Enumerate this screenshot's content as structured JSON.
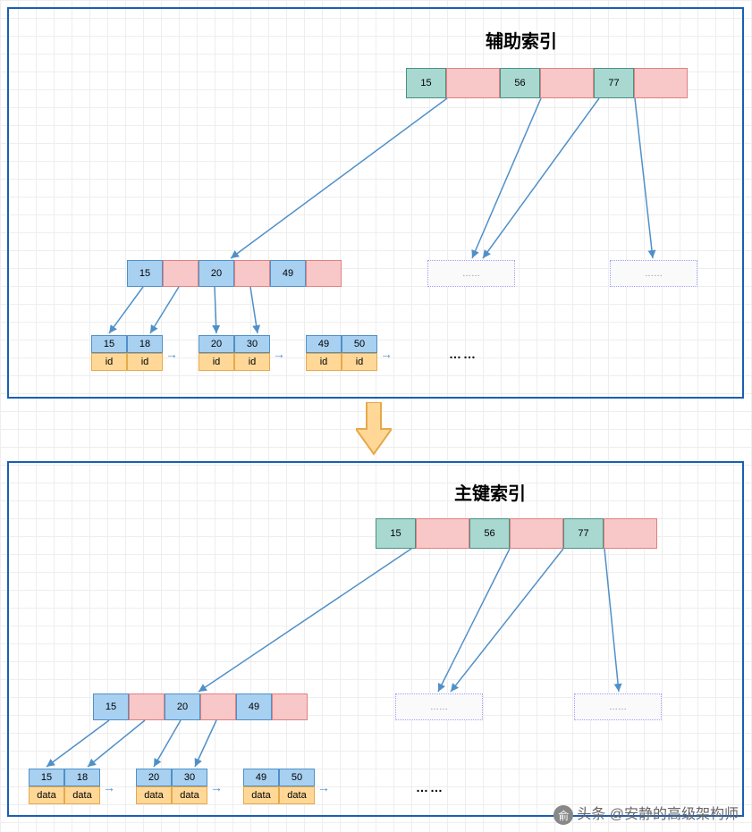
{
  "section1": {
    "title": "辅助索引",
    "root": [
      "15",
      "",
      "56",
      "",
      "77",
      ""
    ],
    "mid": [
      "15",
      "",
      "20",
      "",
      "49",
      ""
    ],
    "leaves": [
      {
        "top": [
          "15",
          "18"
        ],
        "bot": [
          "id",
          "id"
        ]
      },
      {
        "top": [
          "20",
          "30"
        ],
        "bot": [
          "id",
          "id"
        ]
      },
      {
        "top": [
          "49",
          "50"
        ],
        "bot": [
          "id",
          "id"
        ]
      }
    ],
    "placeholder": "……",
    "dots": "……"
  },
  "section2": {
    "title": "主键索引",
    "root": [
      "15",
      "",
      "56",
      "",
      "77",
      ""
    ],
    "mid": [
      "15",
      "",
      "20",
      "",
      "49",
      ""
    ],
    "leaves": [
      {
        "top": [
          "15",
          "18"
        ],
        "bot": [
          "data",
          "data"
        ]
      },
      {
        "top": [
          "20",
          "30"
        ],
        "bot": [
          "data",
          "data"
        ]
      },
      {
        "top": [
          "49",
          "50"
        ],
        "bot": [
          "data",
          "data"
        ]
      }
    ],
    "placeholder": "……",
    "dots": "……"
  },
  "watermark": "头条 @安静的高级架构师"
}
